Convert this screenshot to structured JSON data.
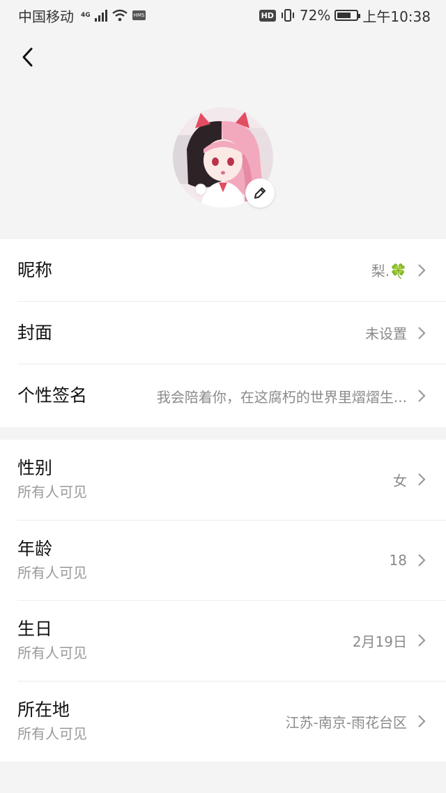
{
  "status_bar": {
    "carrier": "中国移动",
    "network": "4G",
    "hms": "HMS",
    "hd": "HD",
    "battery_pct": "72%",
    "battery_level": 0.72,
    "time": "上午10:38"
  },
  "header": {
    "back_icon": "chevron-left-icon"
  },
  "avatar": {
    "edit_icon": "pencil-icon"
  },
  "profile": {
    "nickname": {
      "label": "昵称",
      "value": "梨.🍀"
    },
    "cover": {
      "label": "封面",
      "value": "未设置"
    },
    "signature": {
      "label": "个性签名",
      "value": "我会陪着你，在这腐朽的世界里熠熠生..."
    }
  },
  "details": {
    "gender": {
      "label": "性别",
      "visibility": "所有人可见",
      "value": "女"
    },
    "age": {
      "label": "年龄",
      "visibility": "所有人可见",
      "value": "18"
    },
    "birthday": {
      "label": "生日",
      "visibility": "所有人可见",
      "value": "2月19日"
    },
    "location": {
      "label": "所在地",
      "visibility": "所有人可见",
      "value": "江苏-南京-雨花台区"
    }
  },
  "colors": {
    "background": "#f4f4f4",
    "card": "#ffffff",
    "value_text": "#8a8a8a",
    "divider": "#ececec"
  }
}
